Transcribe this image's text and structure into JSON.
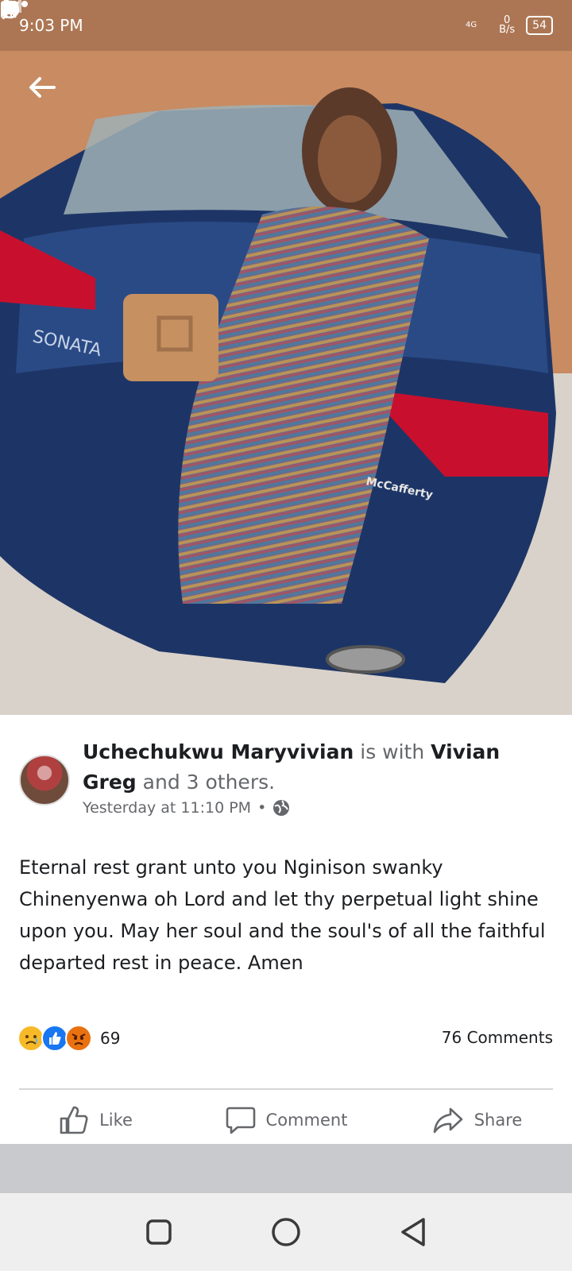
{
  "status_bar": {
    "time": "9:03 PM",
    "network_label": "4G",
    "speed_value": "0",
    "speed_unit": "B/s",
    "battery": "54"
  },
  "post": {
    "author": "Uchechukwu Maryvivian",
    "with_text": "is with",
    "tagged": "Vivian Greg",
    "others_text": "and 3 others.",
    "timestamp": "Yesterday at 11:10 PM",
    "separator": "•",
    "body": "Eternal rest grant unto you Nginison swanky Chinenyenwa oh Lord and let thy perpetual light shine upon you. May her soul and the soul's of all the faithful departed rest in peace. Amen",
    "reaction_count": "69",
    "comments_count": "76 Comments",
    "photo_plate_text": "McCafferty",
    "car_badge": "SONATA"
  },
  "actions": {
    "like_label": "Like",
    "comment_label": "Comment",
    "share_label": "Share"
  },
  "colors": {
    "like_blue": "#1877f2",
    "sad_yellow": "#f7b928",
    "angry_orange": "#e9710f",
    "text_muted": "#65676b"
  },
  "icons": [
    "back-arrow-icon",
    "battery-saver-icon",
    "n-app-icon",
    "whatsapp-icon",
    "more-dots-icon",
    "alarm-icon",
    "mute-icon",
    "signal-icon",
    "globe-icon",
    "like-icon",
    "comment-icon",
    "share-icon",
    "recent-apps-icon",
    "home-icon",
    "back-nav-icon"
  ]
}
